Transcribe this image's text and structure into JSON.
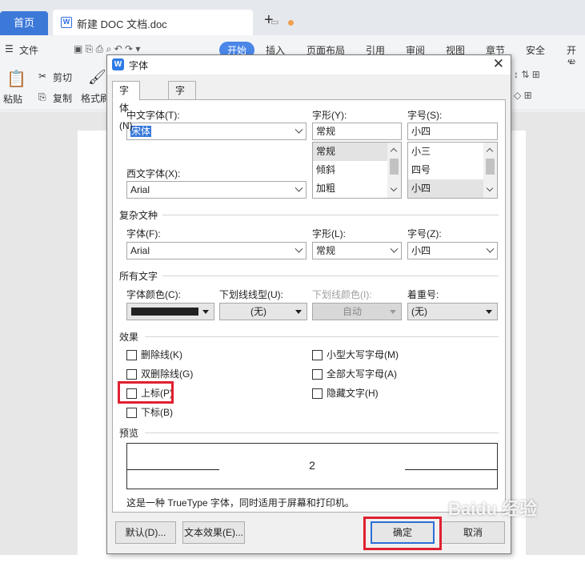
{
  "app": {
    "home_tab": "首页",
    "doc_tab": "新建 DOC 文档.doc",
    "add_tab": "+",
    "menu": [
      "文件",
      "开始",
      "插入",
      "页面布局",
      "引用",
      "审阅",
      "视图",
      "章节",
      "安全",
      "开发"
    ],
    "toolbar": {
      "paste": "粘贴",
      "cut": "剪切",
      "copy": "复制",
      "format_painter": "格式刷"
    }
  },
  "dialog": {
    "title": "字体",
    "tabs": [
      "字体(N)",
      "字符间距(R)"
    ],
    "chinese_font": {
      "label": "中文字体(T):",
      "value": "宋体"
    },
    "style": {
      "label": "字形(Y):",
      "value": "常规",
      "options": [
        "常规",
        "倾斜",
        "加粗"
      ],
      "selected": "常规"
    },
    "size": {
      "label": "字号(S):",
      "value": "小四",
      "options": [
        "小三",
        "四号",
        "小四"
      ],
      "selected": "小四"
    },
    "western_font": {
      "label": "西文字体(X):",
      "value": "Arial"
    },
    "complex": {
      "section": "复杂文种",
      "font_label": "字体(F):",
      "font_value": "Arial",
      "style_label": "字形(L):",
      "style_value": "常规",
      "size_label": "字号(Z):",
      "size_value": "小四"
    },
    "all_text": {
      "section": "所有文字",
      "color_label": "字体颜色(C):",
      "color_value": "#222222",
      "underline_label": "下划线线型(U):",
      "underline_value": "(无)",
      "underline_color_label": "下划线颜色(I):",
      "underline_color_value": "自动",
      "emphasis_label": "着重号:",
      "emphasis_value": "(无)"
    },
    "effects": {
      "section": "效果",
      "strikethrough": "删除线(K)",
      "double_strikethrough": "双删除线(G)",
      "superscript": "上标(P)",
      "subscript": "下标(B)",
      "small_caps": "小型大写字母(M)",
      "all_caps": "全部大写字母(A)",
      "hidden": "隐藏文字(H)"
    },
    "preview": {
      "section": "预览",
      "text": "2",
      "note": "这是一种 TrueType 字体，同时适用于屏幕和打印机。"
    },
    "buttons": {
      "default": "默认(D)...",
      "text_effects": "文本效果(E)...",
      "ok": "确定",
      "cancel": "取消"
    }
  },
  "watermark": "Baidu 经验",
  "colors": {
    "accent": "#3c78d8",
    "highlight": "#e02030"
  }
}
